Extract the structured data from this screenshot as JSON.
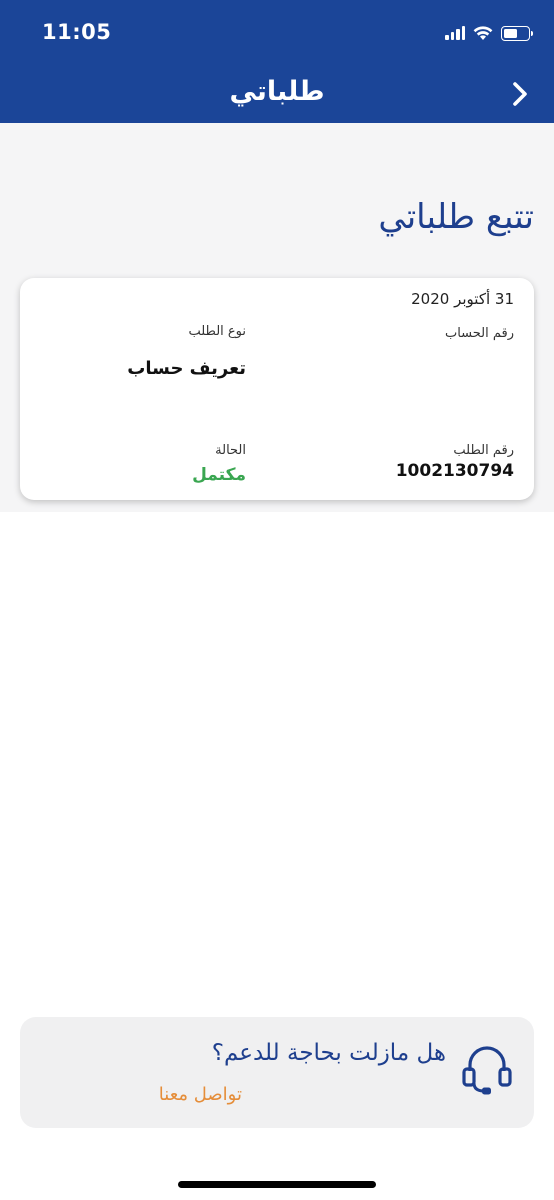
{
  "status_bar": {
    "time": "11:05"
  },
  "header": {
    "title": "طلباتي"
  },
  "page": {
    "title": "تتبع طلباتي"
  },
  "order": {
    "date": "31 أكتوبر 2020",
    "account_label": "رقم الحساب",
    "type_label": "نوع الطلب",
    "type_value": "تعريف حساب",
    "order_number_label": "رقم الطلب",
    "order_number": "1002130794",
    "status_label": "الحالة",
    "status_value": "مكتمل"
  },
  "support": {
    "question": "هل مازلت بحاجة للدعم؟",
    "contact_label": "تواصل معنا"
  },
  "colors": {
    "header_bg": "#1b4598",
    "title_blue": "#1e3f8e",
    "status_green": "#3aa651",
    "link_orange": "#e58d39"
  }
}
